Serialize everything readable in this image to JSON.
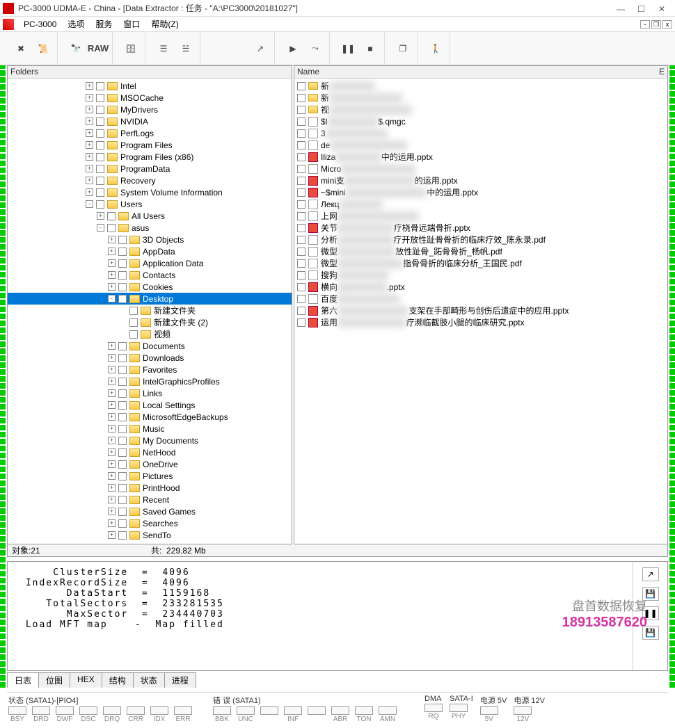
{
  "window": {
    "title": "PC-3000 UDMA-E - China - [Data Extractor : 任务 - \"A:\\PC3000\\20181027\"]"
  },
  "menu": {
    "app": "PC-3000",
    "items": [
      "选项",
      "服务",
      "窗口",
      "帮助(Z)"
    ]
  },
  "toolbar": {
    "binoculars": "🔍",
    "raw": "RAW"
  },
  "left_pane": {
    "title": "Folders"
  },
  "right_pane": {
    "header_name": "Name",
    "header_ext": "E"
  },
  "tree": [
    {
      "d": 7,
      "exp": "+",
      "label": "Intel"
    },
    {
      "d": 7,
      "exp": "+",
      "label": "MSOCache"
    },
    {
      "d": 7,
      "exp": "+",
      "label": "MyDrivers"
    },
    {
      "d": 7,
      "exp": "+",
      "label": "NVIDIA"
    },
    {
      "d": 7,
      "exp": "+",
      "label": "PerfLogs"
    },
    {
      "d": 7,
      "exp": "+",
      "label": "Program Files"
    },
    {
      "d": 7,
      "exp": "+",
      "label": "Program Files (x86)"
    },
    {
      "d": 7,
      "exp": "+",
      "label": "ProgramData"
    },
    {
      "d": 7,
      "exp": "+",
      "label": "Recovery"
    },
    {
      "d": 7,
      "exp": "+",
      "label": "System Volume Information"
    },
    {
      "d": 7,
      "exp": "-",
      "label": "Users"
    },
    {
      "d": 8,
      "exp": "+",
      "label": "All Users"
    },
    {
      "d": 8,
      "exp": "-",
      "label": "asus"
    },
    {
      "d": 9,
      "exp": "+",
      "label": "3D Objects"
    },
    {
      "d": 9,
      "exp": "+",
      "label": "AppData"
    },
    {
      "d": 9,
      "exp": "+",
      "label": "Application Data"
    },
    {
      "d": 9,
      "exp": "+",
      "label": "Contacts"
    },
    {
      "d": 9,
      "exp": "+",
      "label": "Cookies"
    },
    {
      "d": 9,
      "exp": "-",
      "label": "Desktop",
      "selected": true
    },
    {
      "d": 10,
      "exp": " ",
      "label": "新建文件夹"
    },
    {
      "d": 10,
      "exp": " ",
      "label": "新建文件夹 (2)"
    },
    {
      "d": 10,
      "exp": " ",
      "label": "视频"
    },
    {
      "d": 9,
      "exp": "+",
      "label": "Documents"
    },
    {
      "d": 9,
      "exp": "+",
      "label": "Downloads"
    },
    {
      "d": 9,
      "exp": "+",
      "label": "Favorites"
    },
    {
      "d": 9,
      "exp": "+",
      "label": "IntelGraphicsProfiles"
    },
    {
      "d": 9,
      "exp": "+",
      "label": "Links"
    },
    {
      "d": 9,
      "exp": "+",
      "label": "Local Settings"
    },
    {
      "d": 9,
      "exp": "+",
      "label": "MicrosoftEdgeBackups"
    },
    {
      "d": 9,
      "exp": "+",
      "label": "Music"
    },
    {
      "d": 9,
      "exp": "+",
      "label": "My Documents"
    },
    {
      "d": 9,
      "exp": "+",
      "label": "NetHood"
    },
    {
      "d": 9,
      "exp": "+",
      "label": "OneDrive"
    },
    {
      "d": 9,
      "exp": "+",
      "label": "Pictures"
    },
    {
      "d": 9,
      "exp": "+",
      "label": "PrintHood"
    },
    {
      "d": 9,
      "exp": "+",
      "label": "Recent"
    },
    {
      "d": 9,
      "exp": "+",
      "label": "Saved Games"
    },
    {
      "d": 9,
      "exp": "+",
      "label": "Searches"
    },
    {
      "d": 9,
      "exp": "+",
      "label": "SendTo"
    }
  ],
  "files": [
    {
      "icon": "folder",
      "pre": "新",
      "suf": ""
    },
    {
      "icon": "folder",
      "pre": "新",
      "suf": ""
    },
    {
      "icon": "folder",
      "pre": "视",
      "suf": ""
    },
    {
      "icon": "doc",
      "pre": "$I",
      "suf": "$.qmgc"
    },
    {
      "icon": "doc",
      "pre": "3",
      "suf": ""
    },
    {
      "icon": "doc",
      "pre": "de",
      "suf": ""
    },
    {
      "icon": "ppt",
      "pre": "Iliza",
      "suf": "中的运用.pptx"
    },
    {
      "icon": "doc",
      "pre": "Micro",
      "suf": ""
    },
    {
      "icon": "ppt",
      "pre": "mini支",
      "suf": "的运用.pptx"
    },
    {
      "icon": "ppt",
      "pre": "~$mini",
      "suf": "中的运用.pptx"
    },
    {
      "icon": "doc",
      "pre": "Лекц",
      "suf": ""
    },
    {
      "icon": "doc",
      "pre": "上网",
      "suf": ""
    },
    {
      "icon": "ppt",
      "pre": "关节",
      "suf": "疗桡骨远端骨折.pptx"
    },
    {
      "icon": "pdf",
      "pre": "分析",
      "suf": "疗开放性趾骨骨折的临床疗效_陈永录.pdf"
    },
    {
      "icon": "pdf",
      "pre": "微型",
      "suf": "放性趾骨_跖骨骨折_杨帆.pdf"
    },
    {
      "icon": "pdf",
      "pre": "微型",
      "suf": "指骨骨折的临床分析_王国民.pdf"
    },
    {
      "icon": "doc",
      "pre": "搜狗",
      "suf": ""
    },
    {
      "icon": "ppt",
      "pre": "横向",
      "suf": ".pptx"
    },
    {
      "icon": "doc",
      "pre": "百度",
      "suf": ""
    },
    {
      "icon": "ppt",
      "pre": "第六",
      "suf": "支架在手部畸形与创伤后遗症中的应用.pptx"
    },
    {
      "icon": "ppt",
      "pre": "运用",
      "suf": "疗濒临截肢小腿的临床研究.pptx"
    }
  ],
  "status": {
    "objects_label": "对象:",
    "objects": "21",
    "total_label": "共:",
    "total": "229.82 Mb"
  },
  "log": "     ClusterSize  =  4096\n IndexRecordSize  =  4096\n       DataStart  =  1159168\n    TotalSectors  =  233281535\n       MaxSector  =  234440703\n Load MFT map    -  Map filled",
  "tabs": [
    "日志",
    "位图",
    "HEX",
    "结构",
    "状态",
    "进程"
  ],
  "watermark": {
    "line1": "盘首数据恢复",
    "line2": "18913587620"
  },
  "bottom": {
    "sata_label": "状态 (SATA1)-[PIO4]",
    "sata_leds": [
      "BSY",
      "DRD",
      "DWF",
      "DSC",
      "DRQ",
      "CRR",
      "IDX",
      "ERR"
    ],
    "err_label": "错 误 (SATA1)",
    "err_leds": [
      "BBK",
      "UNC",
      "",
      "INF",
      "",
      "ABR",
      "TON",
      "AMN"
    ],
    "dma_label": "DMA",
    "dma_leds": [
      "RQ"
    ],
    "satai_label": "SATA-I",
    "satai_leds": [
      "PHY"
    ],
    "p5_label": "电源 5V",
    "p5_leds": [
      "5V"
    ],
    "p12_label": "电源 12V",
    "p12_leds": [
      "12V"
    ]
  }
}
